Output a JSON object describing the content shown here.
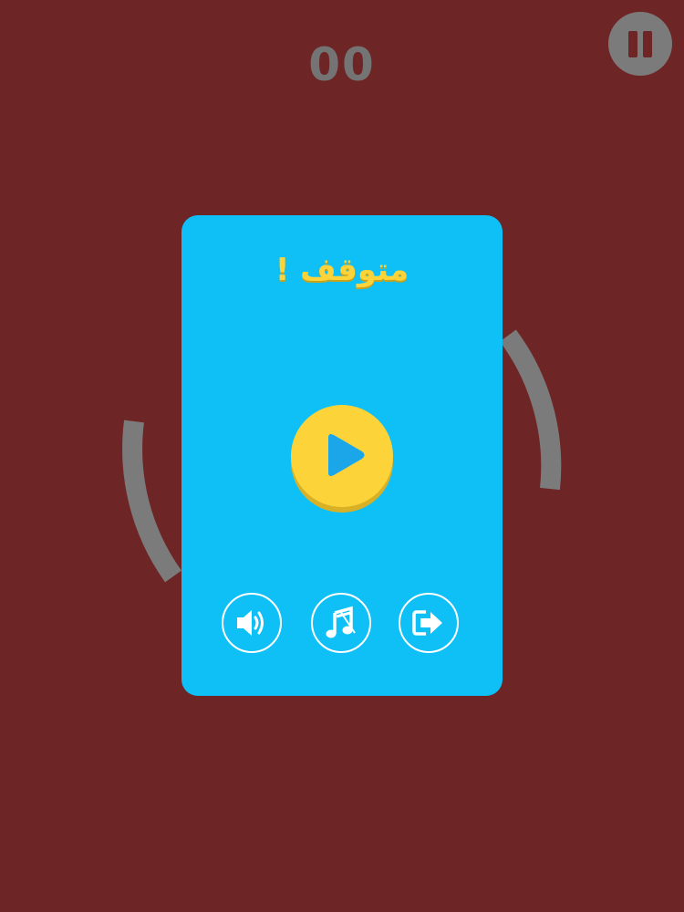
{
  "hud": {
    "score": "00",
    "pause_icon": "pause-icon"
  },
  "pause_menu": {
    "title": "متوقف !",
    "resume_icon": "play-icon",
    "sound_icon": "speaker-volume-icon",
    "music_icon": "music-note-muted-icon",
    "exit_icon": "exit-arrow-icon"
  },
  "colors": {
    "background": "#6e2526",
    "panel": "#0fc0f6",
    "accent_yellow": "#fcd43a",
    "ring_gray": "#7b7b7c",
    "icon_white": "#ffffff"
  }
}
